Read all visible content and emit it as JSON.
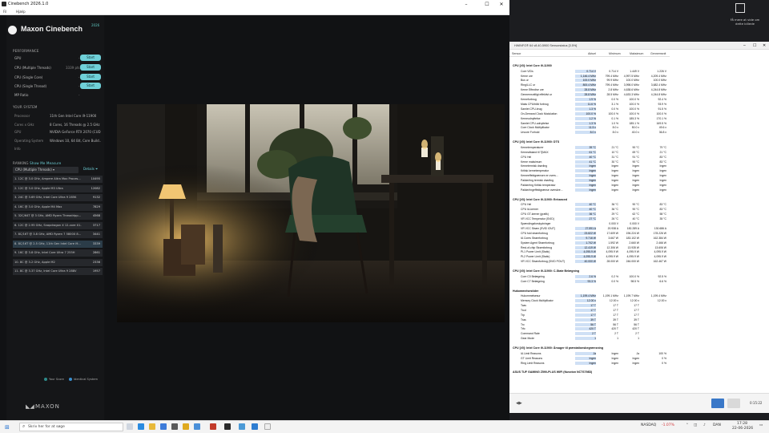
{
  "window": {
    "title": "Cinebench 2026.1.0",
    "menu": [
      "Fil",
      "Hjælp"
    ],
    "minimize": "–",
    "maximize": "☐",
    "close": "✕"
  },
  "brand": {
    "name": "Maxon Cinebench",
    "version": "2026",
    "footer": "MAXON"
  },
  "performance": {
    "heading": "PERFORMANCE",
    "rows": [
      {
        "label": "GPU",
        "value": "-",
        "button": "Start"
      },
      {
        "label": "CPU (Multiple Threads)",
        "value": "3339 pts",
        "button": "Start"
      },
      {
        "label": "CPU (Single Core)",
        "value": "-",
        "button": "Start"
      },
      {
        "label": "CPU (Single Thread)",
        "value": "-",
        "button": "Start"
      },
      {
        "label": "MP Ratio",
        "value": "-",
        "button": ""
      }
    ]
  },
  "system": {
    "heading": "YOUR SYSTEM",
    "rows": [
      {
        "key": "Processor",
        "value": "11th Gen Intel Core i9-11900"
      },
      {
        "key": "Cores x GHz",
        "value": "8 Cores, 16 Threads @ 2.5 GHz"
      },
      {
        "key": "GPU",
        "value": "NVIDIA GeForce RTX 2070 (CUD..."
      },
      {
        "key": "Operating System",
        "value": "Windows 10, 64 Bit, Core Build..."
      },
      {
        "key": "Info",
        "value": ""
      }
    ]
  },
  "ranking": {
    "heading": "RANKING",
    "show_me": "Show Me Measure",
    "dropdown": "CPU (Multiple Threads)",
    "details": "Details",
    "rows": [
      {
        "name": "1. 12C @ 3.0 GHz, Ampere Altra Max Proces...",
        "score": "10495"
      },
      {
        "name": "2. 12C @ 3.0 GHz, Apple M3 Ultra",
        "score": "12082"
      },
      {
        "name": "3. 24C @ 3.69 GHz, Intel Core Ultra 9 285K",
        "score": "9132"
      },
      {
        "name": "4. 16C @ 3.0 GHz, Apple M4 Max",
        "score": "7829"
      },
      {
        "name": "5. 32C/64T @ 3 GHz, AMD Ryzen Threadripp...",
        "score": "4568"
      },
      {
        "name": "6. 12C @ 2.95 GHz, Snapdragon X 12-core X1...",
        "score": "3717"
      },
      {
        "name": "7. 8C/16T @ 3.8 GHz, AMD Ryzen 7 5800X 8...",
        "score": "3441"
      },
      {
        "name": "8. 8C/16T @ 2.5 GHz, 11th Gen Intel Core i9...",
        "score": "3339"
      },
      {
        "name": "9. 16C @ 3.8 GHz, Intel Core Ultra 7 255H",
        "score": "2861"
      },
      {
        "name": "10. 8C @ 3.2 GHz, Apple M2",
        "score": "2336"
      },
      {
        "name": "11. 8C @ 3.37 GHz, Intel Core Ultra 9 288V",
        "score": "1957"
      }
    ],
    "legend_you": "Your Score",
    "legend_identical": "Identical System"
  },
  "hwinfo": {
    "title": "HWiNFO® 64 v8.40-5900 Sensorstatus [3.5%]",
    "columns": [
      "Sensor",
      "Aktuel",
      "Minimum",
      "Maksimum",
      "Gennemsnit"
    ],
    "groups": [
      {
        "name": "CPU [#0]: Intel Core i9-11900",
        "rows": [
          [
            "Core VIDs",
            "0.714 V",
            "0.714 V",
            "1.449 V",
            "1.226 V"
          ],
          [
            "Kerne ure",
            "1,146.4 MHz",
            "799.4 MHz",
            "4,997.5 MHz",
            "4,209.4 MHz"
          ],
          [
            "Bus ur",
            "100.0 MHz",
            "99.9 MHz",
            "100.0 MHz",
            "100.0 MHz"
          ],
          [
            "Ring/LLC ur",
            "800.4 MHz",
            "799.4 MHz",
            "3,998.0 MHz",
            "3,682.4 MHz"
          ],
          [
            "Kerne Effective ure",
            "28.8 MHz",
            "2.8 MHz",
            "4,638.6 MHz",
            "4,244.8 MHz"
          ],
          [
            "Gennemsnitligt effektivt ur",
            "28.8 MHz",
            "28.5 MHz",
            "4,633.3 MHz",
            "4,244.8 MHz"
          ],
          [
            "Kerneforbrug",
            "1.9 %",
            "0.0 %",
            "100.0 %",
            "92.4 %"
          ],
          [
            "Maks CPU/tråd forbrug",
            "11.6 %",
            "3.1 %",
            "100.0 %",
            "93.9 %"
          ],
          [
            "Samlet CPU-brug",
            "1.3 %",
            "0.0 %",
            "100.0 %",
            "91.5 %"
          ],
          [
            "On-Demand Clock Modulation",
            "100.0 %",
            "100.0 %",
            "100.0 %",
            "100.0 %"
          ],
          [
            "Kerneudnyttelse",
            "1.2 %",
            "0.1 %",
            "185.3 %",
            "170.1 %"
          ],
          [
            "Samlet CPU-udnyttelse",
            "1.3 %",
            "1.0 %",
            "185.1 %",
            "169.5 %"
          ],
          [
            "Core Clock Multiplikator",
            "11.5 x",
            "8.0 x",
            "50.0 x",
            "49.6 x"
          ],
          [
            "Uncore Forhold",
            "8.0 x",
            "8.0 x",
            "40.0 x",
            "36.8 x"
          ]
        ]
      },
      {
        "name": "CPU [#0]: Intel Core i9-11900: DTS",
        "rows": [
          [
            "Kernetemperaturer",
            "39 °C",
            "21 °C",
            "90 °C",
            "79 °C"
          ],
          [
            "Kerneafstand til TjMAX",
            "61 °C",
            "10 °C",
            "69 °C",
            "21 °C"
          ],
          [
            "CPU Hel",
            "40 °C",
            "31 °C",
            "91 °C",
            "83 °C"
          ],
          [
            "Kerne maksimum",
            "41 °C",
            "30 °C",
            "90 °C",
            "83 °C"
          ],
          [
            "Kernetermisk drøvling",
            "Ingen",
            "Ingen",
            "Ingen",
            "Ingen"
          ],
          [
            "Kritisk kernetemperatur",
            "Ingen",
            "Ingen",
            "Ingen",
            "Ingen"
          ],
          [
            "Kerneeffektgrænsen er overs...",
            "Ingen",
            "Ingen",
            "Ingen",
            "Ingen"
          ],
          [
            "Pakke/ring termisk drøvling",
            "Ingen",
            "Ingen",
            "Ingen",
            "Ingen"
          ],
          [
            "Pakke/ring Kritisk temperatur",
            "Ingen",
            "Ingen",
            "Ingen",
            "Ingen"
          ],
          [
            "Pakke/ringeffektgrænse overskre...",
            "Ingen",
            "Ingen",
            "Ingen",
            "Ingen"
          ]
        ]
      },
      {
        "name": "CPU [#0]: Intel Core i9-11900: Enhanced",
        "rows": [
          [
            "CPU Hel",
            "40 °C",
            "36 °C",
            "90 °C",
            "83 °C"
          ],
          [
            "CPU IA-kerner",
            "40 °C",
            "36 °C",
            "90 °C",
            "83 °C"
          ],
          [
            "CPU GT-kerner (grafik)",
            "36 °C",
            "29 °C",
            "62 °C",
            "58 °C"
          ],
          [
            "VR VCC Temperatur (SVID)",
            "27 °C",
            "26 °C",
            "40 °C",
            "35 °C"
          ],
          [
            "Spændingsforskydninger",
            "",
            "0.000 V",
            "0.000 V",
            ""
          ],
          [
            "VR VCC Strøm (SVID IOUT)",
            "27.891 A",
            "20.938 A",
            "182.289 A",
            "130.686 A"
          ],
          [
            "CPU fuld strømforbrug",
            "23.822 W",
            "17.609 W",
            "196.224 W",
            "178.226 W"
          ],
          [
            "IA Cores Strømforbrug",
            "9.716 W",
            "3.667 W",
            "183.102 W",
            "162.384 W"
          ],
          [
            "System Agent Strømforbrug",
            "1.702 W",
            "1.592 W",
            "2.660 W",
            "2.466 W"
          ],
          [
            "Rest-of-chip Strømforbrug",
            "12.419 W",
            "12.306 W",
            "13.935 W",
            "13.606 W"
          ],
          [
            "PL1 Power Limit (Static)",
            "4,095.9 W",
            "4,095.9 W",
            "4,095.9 W",
            "4,095.9 W"
          ],
          [
            "PL2 Power Limit (Static)",
            "4,095.9 W",
            "4,095.9 W",
            "4,095.9 W",
            "4,095.9 W"
          ],
          [
            "VR VCC Strømforbrug (SVID POUT)",
            "40.000 W",
            "28.000 W",
            "246.000 W",
            "162.467 W"
          ]
        ]
      },
      {
        "name": "CPU [#0]: Intel Core i9-11900: C-State Belægning",
        "rows": [
          [
            "Core C0 Belægning",
            "2.6 %",
            "0.2 %",
            "100.0 %",
            "92.5 %"
          ],
          [
            "Core C7 Belægning",
            "93.3 %",
            "0.0 %",
            "98.5 %",
            "6.6 %"
          ]
        ]
      },
      {
        "name": "Hukommelsestider",
        "rows": [
          [
            "Hukommelsesur",
            "1,199.4 MHz",
            "1,199.1 MHz",
            "1,199.7 MHz",
            "1,199.4 MHz"
          ],
          [
            "Memory Clock Multiplikator",
            "12.00 x",
            "12.00 x",
            "12.00 x",
            "12.00 x"
          ],
          [
            "Tcas",
            "17 T",
            "17 T",
            "17 T",
            ""
          ],
          [
            "Trcd",
            "17 T",
            "17 T",
            "17 T",
            ""
          ],
          [
            "Trp",
            "17 T",
            "17 T",
            "17 T",
            ""
          ],
          [
            "Tras",
            "39 T",
            "39 T",
            "39 T",
            ""
          ],
          [
            "Trc",
            "56 T",
            "56 T",
            "56 T",
            ""
          ],
          [
            "Trfc",
            "420 T",
            "420 T",
            "420 T",
            ""
          ],
          [
            "Command Rate",
            "2 T",
            "2 T",
            "2 T",
            ""
          ],
          [
            "Gear Mode",
            "1",
            "1",
            "1",
            ""
          ]
        ]
      },
      {
        "name": "CPU [#0]: Intel Core i9-11900: Årsager til præstationsbegrænsning",
        "rows": [
          [
            "IA Limit Reasons",
            "Ja",
            "Ingen",
            "Ja",
            "100 %"
          ],
          [
            "GT Limit Reasons",
            "Ingen",
            "Ingen",
            "Ingen",
            "0 %"
          ],
          [
            "Ring Limit Reasons",
            "Ingen",
            "Ingen",
            "Ingen",
            "0 %"
          ]
        ]
      },
      {
        "name": "ASUS TUF GAMING Z590-PLUS WIFI (Nuvoton NCT6798D)",
        "rows": []
      }
    ],
    "timer": "0:15:22"
  },
  "notification": {
    "text": "Få mere at vide om dette billede"
  },
  "taskbar": {
    "search_placeholder": "Skriv her for at søge",
    "ticker": "NASDAQ",
    "ticker_change": "-1.07%",
    "language": "DAN",
    "time": "17:28",
    "date": "22-06-2026"
  },
  "colors": {
    "accent": "#6fd0d8",
    "my_row": "#2b3c48",
    "you_dot": "#2e8b8b",
    "identical_dot": "#3a8fd0",
    "ticker_down": "#d13438"
  }
}
